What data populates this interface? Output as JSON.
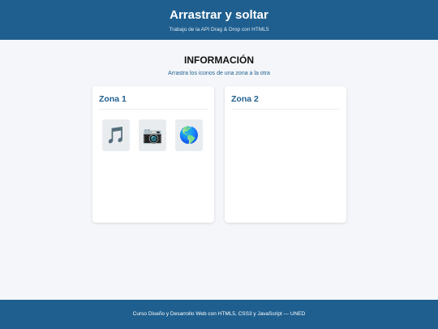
{
  "header": {
    "title": "Arrastrar y soltar",
    "subtitle": "Trabajo de la API Drag & Drop con HTML5"
  },
  "intro": {
    "heading": "INFORMACIÓN",
    "instruction": "Arrastra los iconos de una zona a la otra"
  },
  "zones": [
    {
      "title": "Zona 1",
      "items": [
        {
          "icon": "musical-note-icon",
          "glyph": "🎵"
        },
        {
          "icon": "camera-icon",
          "glyph": "📷"
        },
        {
          "icon": "globe-icon",
          "glyph": "🌎"
        }
      ]
    },
    {
      "title": "Zona 2",
      "items": []
    }
  ],
  "footer": {
    "text": "Curso Diseño y Desarrollo Web con HTML5, CSS3 y JavaScript — UNED"
  },
  "colors": {
    "primary": "#1f5f8f",
    "background": "#f4f6f9",
    "tile": "#e9ecef"
  }
}
